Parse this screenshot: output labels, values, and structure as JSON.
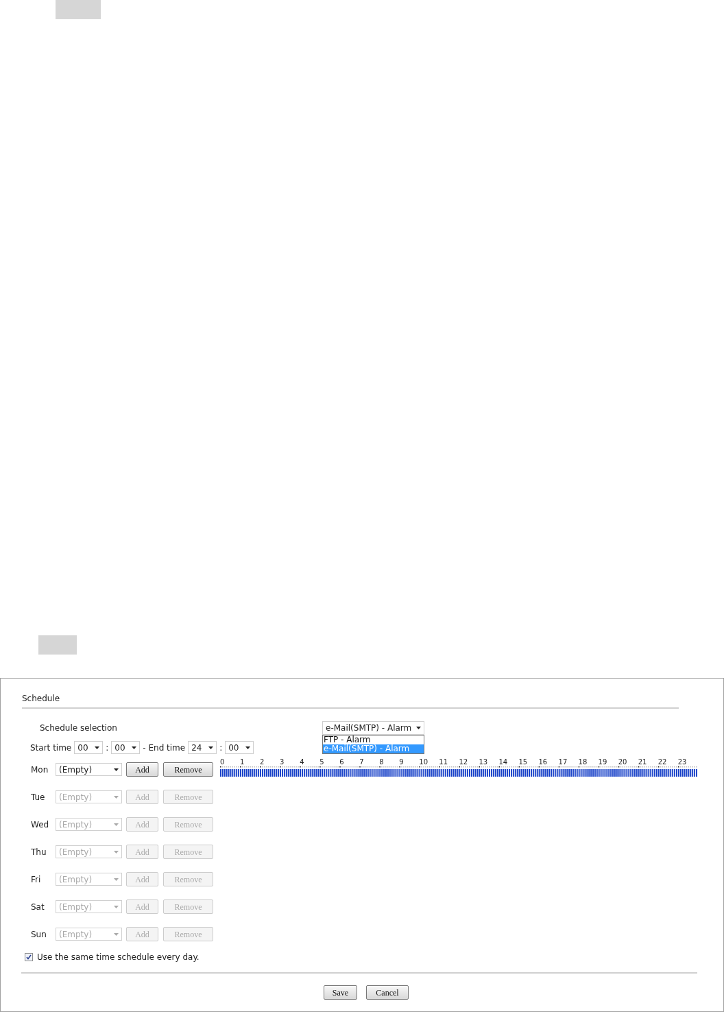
{
  "panel": {
    "title": "Schedule"
  },
  "schedule_selection": {
    "label": "Schedule selection",
    "value": "e-Mail(SMTP) - Alarm",
    "expanded": true,
    "options": [
      {
        "label": "FTP - Alarm",
        "selected": false
      },
      {
        "label": "e-Mail(SMTP) - Alarm",
        "selected": true
      }
    ]
  },
  "time_range": {
    "start_label": "Start time",
    "start_hour": "00",
    "separator_1": ":",
    "start_minute": "00",
    "end_label": "- End time",
    "end_hour": "24",
    "separator_2": ":",
    "end_minute": "00"
  },
  "hour_labels": [
    "0",
    "1",
    "2",
    "3",
    "4",
    "5",
    "6",
    "7",
    "8",
    "9",
    "10",
    "11",
    "12",
    "13",
    "14",
    "15",
    "16",
    "17",
    "18",
    "19",
    "20",
    "21",
    "22",
    "23"
  ],
  "days": [
    {
      "label": "Mon",
      "value": "(Empty)",
      "disabled": false,
      "schedule_bar": true,
      "add": "Add",
      "remove": "Remove"
    },
    {
      "label": "Tue",
      "value": "(Empty)",
      "disabled": true,
      "schedule_bar": false,
      "add": "Add",
      "remove": "Remove"
    },
    {
      "label": "Wed",
      "value": "(Empty)",
      "disabled": true,
      "schedule_bar": false,
      "add": "Add",
      "remove": "Remove"
    },
    {
      "label": "Thu",
      "value": "(Empty)",
      "disabled": true,
      "schedule_bar": false,
      "add": "Add",
      "remove": "Remove"
    },
    {
      "label": "Fri",
      "value": "(Empty)",
      "disabled": true,
      "schedule_bar": false,
      "add": "Add",
      "remove": "Remove"
    },
    {
      "label": "Sat",
      "value": "(Empty)",
      "disabled": true,
      "schedule_bar": false,
      "add": "Add",
      "remove": "Remove"
    },
    {
      "label": "Sun",
      "value": "(Empty)",
      "disabled": true,
      "schedule_bar": false,
      "add": "Add",
      "remove": "Remove"
    }
  ],
  "same_schedule": {
    "label": "Use the same time schedule every day.",
    "checked": true
  },
  "buttons": [
    "Save",
    "Cancel"
  ]
}
